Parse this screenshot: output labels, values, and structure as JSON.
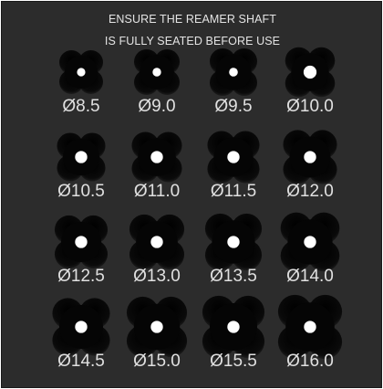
{
  "notice": {
    "line1": "ENSURE THE REAMER SHAFT",
    "line2": "IS FULLY SEATED BEFORE USE"
  },
  "sockets": [
    {
      "label": "Ø8.5",
      "lobe": 0.42,
      "hole": 0.11
    },
    {
      "label": "Ø9.0",
      "lobe": 0.46,
      "hole": 0.12
    },
    {
      "label": "Ø9.5",
      "lobe": 0.5,
      "hole": 0.13
    },
    {
      "label": "Ø10.0",
      "lobe": 0.55,
      "hole": 0.34
    },
    {
      "label": "Ø10.5",
      "lobe": 0.52,
      "hole": 0.3
    },
    {
      "label": "Ø11.0",
      "lobe": 0.56,
      "hole": 0.3
    },
    {
      "label": "Ø11.5",
      "lobe": 0.6,
      "hole": 0.3
    },
    {
      "label": "Ø12.0",
      "lobe": 0.64,
      "hole": 0.3
    },
    {
      "label": "Ø12.5",
      "lobe": 0.62,
      "hole": 0.3
    },
    {
      "label": "Ø13.0",
      "lobe": 0.66,
      "hole": 0.3
    },
    {
      "label": "Ø13.5",
      "lobe": 0.7,
      "hole": 0.3
    },
    {
      "label": "Ø14.0",
      "lobe": 0.75,
      "hole": 0.3
    },
    {
      "label": "Ø14.5",
      "lobe": 0.72,
      "hole": 0.3
    },
    {
      "label": "Ø15.0",
      "lobe": 0.78,
      "hole": 0.3
    },
    {
      "label": "Ø15.5",
      "lobe": 0.82,
      "hole": 0.3
    },
    {
      "label": "Ø16.0",
      "lobe": 0.86,
      "hole": 0.3
    }
  ],
  "colors": {
    "panel": "#2c2c2c",
    "recess": "#050505",
    "hole": "#ffffff",
    "text": "#e0e0e0"
  }
}
